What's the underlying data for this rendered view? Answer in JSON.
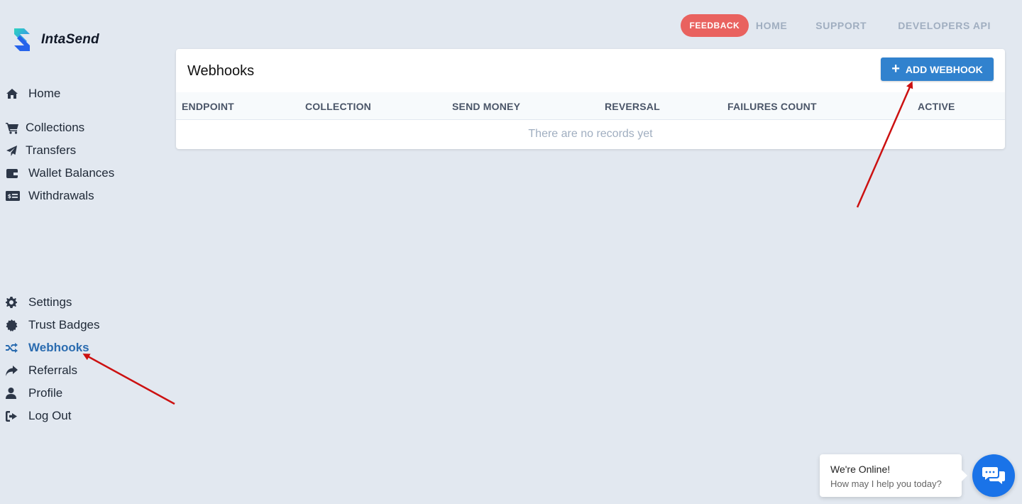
{
  "brand": {
    "name": "IntaSend"
  },
  "topnav": {
    "feedback": "FEEDBACK",
    "home": "HOME",
    "support": "SUPPORT",
    "developers": "DEVELOPERS API"
  },
  "sidebar": {
    "items": [
      {
        "label": "Home",
        "icon": "home-icon"
      },
      {
        "label": "Collections",
        "icon": "cart-icon"
      },
      {
        "label": "Transfers",
        "icon": "paper-plane-icon"
      },
      {
        "label": "Wallet Balances",
        "icon": "wallet-icon"
      },
      {
        "label": "Withdrawals",
        "icon": "money-check-icon"
      },
      {
        "label": "Settings",
        "icon": "gear-icon"
      },
      {
        "label": "Trust Badges",
        "icon": "certificate-icon"
      },
      {
        "label": "Webhooks",
        "icon": "shuffle-icon"
      },
      {
        "label": "Referrals",
        "icon": "share-icon"
      },
      {
        "label": "Profile",
        "icon": "user-icon"
      },
      {
        "label": "Log Out",
        "icon": "sign-out-icon"
      }
    ],
    "active": "Webhooks"
  },
  "main": {
    "title": "Webhooks",
    "add_button": "ADD WEBHOOK",
    "columns": [
      "ENDPOINT",
      "COLLECTION",
      "SEND MONEY",
      "REVERSAL",
      "FAILURES COUNT",
      "ACTIVE"
    ],
    "empty_text": "There are no records yet"
  },
  "chat": {
    "title": "We're Online!",
    "subtitle": "How may I help you today?"
  },
  "colors": {
    "background": "#e2e8f0",
    "accent": "#3182ce",
    "feedback": "#e9625f",
    "active_link": "#2b6cb0",
    "annotation_arrow": "#cc1111"
  }
}
